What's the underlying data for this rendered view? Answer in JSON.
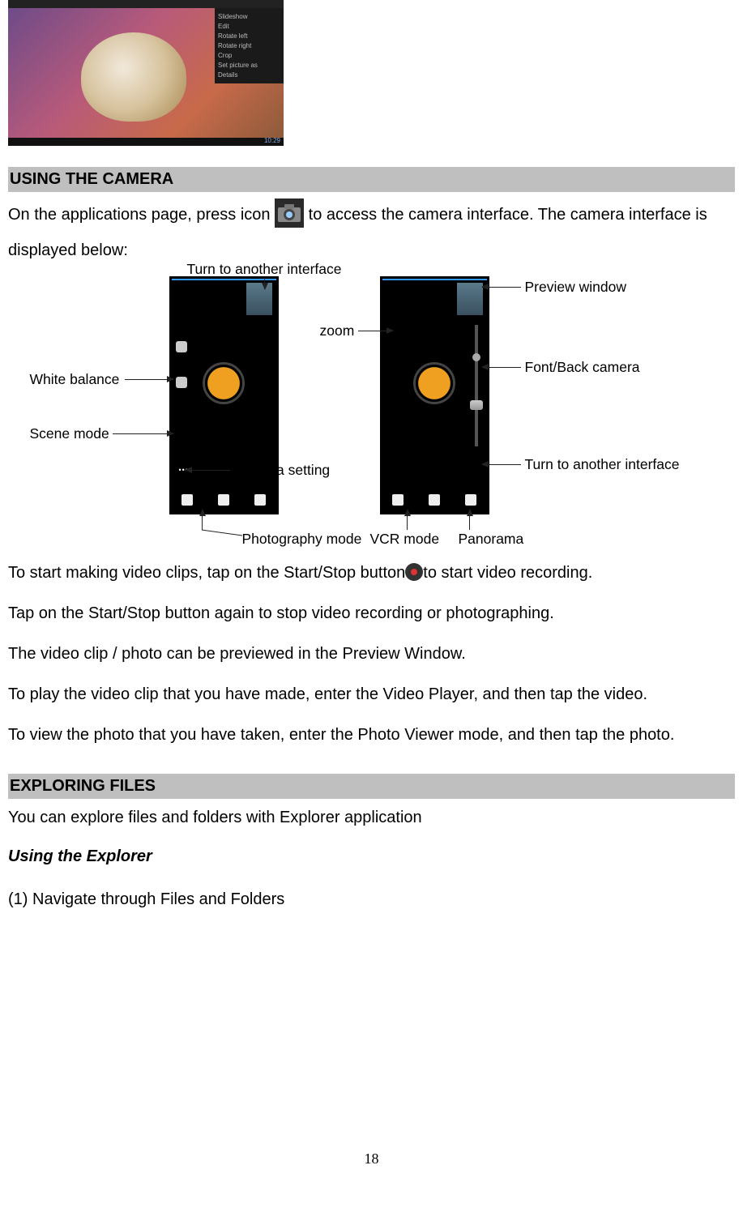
{
  "top_screenshot": {
    "menu_items": [
      "Slideshow",
      "Edit",
      "Rotate left",
      "Rotate right",
      "Crop",
      "Set picture as",
      "Details"
    ],
    "time": "10:29"
  },
  "section1": {
    "heading": "USING THE CAMERA",
    "para1_a": "On the applications page, press icon ",
    "para1_b": " to access the camera interface. The camera interface is displayed below:",
    "labels": {
      "turn_interface": "Turn to another interface",
      "white_balance": "White balance",
      "scene_mode": "Scene mode",
      "camera_setting": "Camera setting",
      "zoom": "zoom",
      "preview_window": "Preview window",
      "font_back": "Font/Back camera",
      "turn_interface2": "Turn to another interface",
      "photography_mode": "Photography mode",
      "vcr_mode": "VCR mode",
      "panorama": "Panorama"
    },
    "para2a": "To start making video clips, tap on the Start/Stop button",
    "para2b": "to start video recording.",
    "para3": "Tap on the Start/Stop button again to stop video recording or photographing.",
    "para4": "The video clip / photo can be previewed in the Preview Window.",
    "para5": "To play the video clip that you have made, enter the Video Player, and then tap the video.",
    "para6": "To view the photo that you have taken, enter the Photo Viewer mode, and then tap the photo."
  },
  "section2": {
    "heading": "EXPLORING FILES",
    "para1": "You can explore files and folders with Explorer application",
    "subheading": "Using the Explorer",
    "item1": "(1) Navigate through Files and Folders"
  },
  "page_number": "18"
}
